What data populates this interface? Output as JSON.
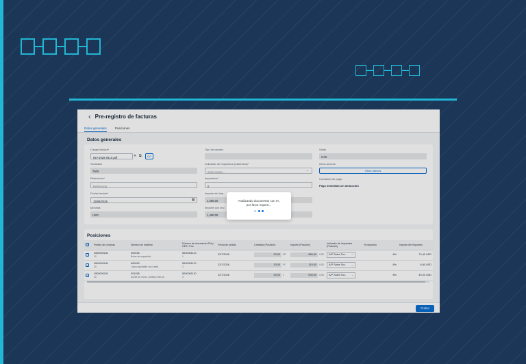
{
  "app": {
    "title": "Pre-registro de facturas",
    "tabs": [
      {
        "label": "Datos generales",
        "active": true
      },
      {
        "label": "Posiciones",
        "active": false
      }
    ]
  },
  "general": {
    "section_title": "Datos generales",
    "cargar_factura": {
      "label": "Cargar factura*",
      "value": "INV-2026-0410.pdf",
      "go_label": "GO"
    },
    "sociedad": {
      "label": "Sociedad",
      "value": "7600"
    },
    "referencia": {
      "label": "Referencia*",
      "placeholder": "Referencia"
    },
    "fecha_factura": {
      "label": "Fecha factura*",
      "value": "15/08/2026"
    },
    "moneda": {
      "label": "Moneda",
      "value": "USD"
    },
    "tipo_cambio": {
      "label": "Tipo de cambio",
      "value": ""
    },
    "indicador_impuestos": {
      "label": "Indicador de Impuestos (Cabecera)*",
      "placeholder": "Seleccionar..."
    },
    "impuestos": {
      "label": "Impuestos*",
      "value": "0"
    },
    "importe_sin_imp": {
      "label": "Importe sin imp",
      "value": "1,490.00"
    },
    "importe_con_imp": {
      "label": "Importe con imp",
      "value": "1,490.00"
    },
    "saldo": {
      "label": "Saldo",
      "value": "0,00"
    },
    "otros_anexos": {
      "label": "Otros anexos",
      "button_label": "Otros anexos"
    },
    "condicion_pago": {
      "label": "Condición de pago",
      "value": "Pago inmediato sin deducción"
    }
  },
  "positions": {
    "title": "Posiciones",
    "headers": [
      "Pedido de compras",
      "Número de material",
      "Número de documento EM y HES / Pos",
      "Fecha de pedido",
      "Cantidad (Posición)",
      "Importe (Posición)",
      "Indicador de Impuestos (Posición)",
      "% Impuesto",
      "Importe del Impuesto"
    ],
    "rows": [
      {
        "po": "4500000241",
        "po_item": "10",
        "mat": "300018",
        "mat_desc": "Botas de seguridad",
        "doc": "5000001110",
        "doc_pos": "1",
        "date": "22/7/2026",
        "qty": "20,00",
        "qty_unit": "PR",
        "amount": "880,00",
        "currency": "USD",
        "tax": "A/P Sales Tax...",
        "tax_pct": "8%",
        "tax_amount": "70,40 USD"
      },
      {
        "po": "4500000241",
        "po_item": "20",
        "mat": "600030",
        "mat_desc": "Casco ajustable con rueda",
        "doc": "5000001110",
        "doc_pos": "2",
        "date": "22/7/2026",
        "qty": "10,00",
        "qty_unit": "PC",
        "amount": "110,00",
        "currency": "USD",
        "tax": "A/P Sales Tax...",
        "tax_pct": "8%",
        "tax_amount": "8,80 USD"
      },
      {
        "po": "4500000241",
        "po_item": "30",
        "mat": "301038",
        "mat_desc": "Aceite de motor, sintético 5W-30",
        "doc": "5000001110",
        "doc_pos": "3",
        "date": "22/7/2026",
        "qty": "40,00",
        "qty_unit": "L",
        "amount": "500,00",
        "currency": "USD",
        "tax": "A/P Sales Tax...",
        "tax_pct": "8%",
        "tax_amount": "40,00 USD"
      }
    ]
  },
  "footer": {
    "save_label": "Grabar"
  },
  "dialog": {
    "line1": "Analizando documento con IA,",
    "line2": "por favor espere..."
  },
  "colors": {
    "background": "#1b3657",
    "accent": "#22b7d4",
    "primary": "#0a6ed1"
  }
}
